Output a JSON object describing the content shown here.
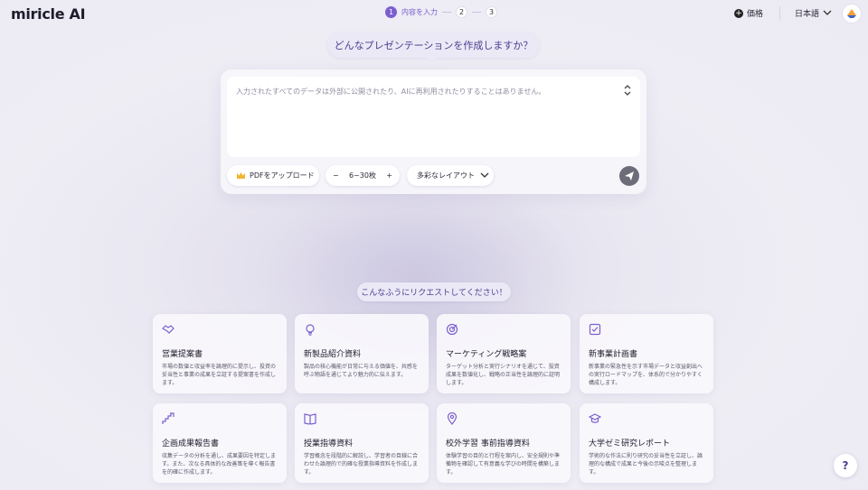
{
  "header": {
    "logo": "miricle AI",
    "steps": [
      {
        "number": "1",
        "label": "内容を入力"
      },
      {
        "number": "2"
      },
      {
        "number": "3"
      }
    ],
    "price_label": "価格",
    "language": "日本語"
  },
  "main": {
    "question": "どんなプレゼンテーションを作成しますか？",
    "input_placeholder": "入力されたすべてのデータは外部に公開されたり、AIに再利用されたりすることはありません。",
    "upload_label": "PDFをアップロード",
    "count_minus": "−",
    "count_label": "6~30枚",
    "count_plus": "+",
    "layout_label": "多彩なレイアウト"
  },
  "suggest_label": "こんなふうにリクエストしてください！",
  "cards": [
    {
      "icon": "handshake-icon",
      "title": "営業提案書",
      "desc": "市場の数値と収益率を論理的に提示し、投資の妥当性と事業の成果を立証する提案書を作成します。"
    },
    {
      "icon": "lightbulb-icon",
      "title": "新製品紹介資料",
      "desc": "製品の核心機能が日常に与える価値を、共感を呼ぶ物語を通じてより魅力的に伝えます。"
    },
    {
      "icon": "target-icon",
      "title": "マーケティング戦略案",
      "desc": "ターゲット分析と実行シナリオを通じて、投資成果を数値化し、戦略の正当性を論理的に証明します。"
    },
    {
      "icon": "checklist-icon",
      "title": "新事業計画書",
      "desc": "新事業の緊急性を示す市場データと収益創出への実行ロードマップを、体系的で分かりやすく構成します。"
    },
    {
      "icon": "growth-chart-icon",
      "title": "企画成果報告書",
      "desc": "収集データの分析を通し、成果要因を特定します。また、次なる具体的な改善策を導く報告書を的確に作成します。"
    },
    {
      "icon": "book-icon",
      "title": "授業指導資料",
      "desc": "学習概念を段階的に解説し、学習者の目線に合わせた論理的で的確な授業指導資料を作成します。"
    },
    {
      "icon": "location-pin-icon",
      "title": "校外学習 事前指導資料",
      "desc": "体験学習の目的と行程を案内し、安全規則や準備物を確認して有意義な学びの時間を構築します。"
    },
    {
      "icon": "graduation-cap-icon",
      "title": "大学ゼミ研究レポート",
      "desc": "学術的な作法に則り研究の妥当性を立証し、論理的な構成で成果と今後の示唆点を整理します。"
    }
  ],
  "help_label": "?"
}
